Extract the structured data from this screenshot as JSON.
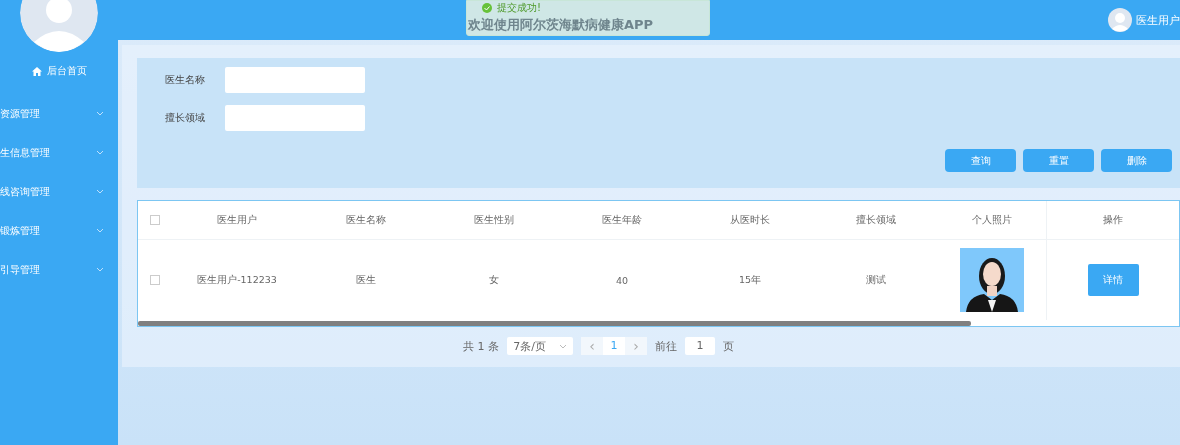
{
  "sidebar": {
    "home": "后台首页",
    "items": [
      {
        "label": "资源管理"
      },
      {
        "label": "生信息管理"
      },
      {
        "label": "线咨询管理"
      },
      {
        "label": "锻炼管理"
      },
      {
        "label": "引导管理"
      }
    ]
  },
  "header": {
    "title": "欢迎使用阿尔茨海默病健康APP",
    "toast": "提交成功!",
    "user": "医生用户"
  },
  "search": {
    "fields": [
      {
        "label": "医生名称"
      },
      {
        "label": "擅长领域"
      }
    ],
    "buttons": [
      "查询",
      "重置",
      "删除"
    ]
  },
  "table": {
    "columns": [
      "医生用户",
      "医生名称",
      "医生性别",
      "医生年龄",
      "从医时长",
      "擅长领域",
      "个人照片",
      "操作"
    ],
    "rows": [
      {
        "checked": false,
        "cells": [
          "医生用户-112233",
          "医生",
          "女",
          "40",
          "15年",
          "测试"
        ],
        "action": "详情"
      }
    ],
    "header_checked": false
  },
  "pagination": {
    "total": "共 1 条",
    "page_size": "7条/页",
    "prev": "‹",
    "next": "›",
    "pages": [
      {
        "label": "1",
        "selected": true
      }
    ],
    "goto_label": "前往",
    "goto_value": "1",
    "goto_suffix": "页"
  }
}
